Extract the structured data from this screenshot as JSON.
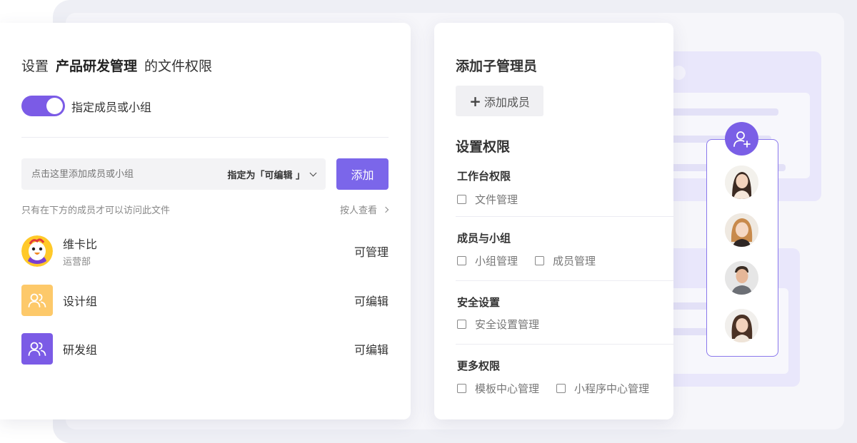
{
  "left_card": {
    "title_prefix": "设置",
    "title_name": "产品研发管理",
    "title_suffix": "的文件权限",
    "toggle_label": "指定成员或小组",
    "add_placeholder": "点击这里添加成员或小组",
    "perm_select": "指定为「可编辑 」",
    "add_button": "添加",
    "hint": "只有在下方的成员才可以访问此文件",
    "by_person": "按人查看",
    "members": [
      {
        "name": "维卡比",
        "dept": "运营部",
        "perm": "可管理",
        "avatar": "chick-avatar"
      },
      {
        "name": "设计组",
        "perm": "可编辑",
        "avatar": "group-icon",
        "color": "#fdc96a"
      },
      {
        "name": "研发组",
        "perm": "可编辑",
        "avatar": "group-icon",
        "color": "#7b5be6"
      }
    ]
  },
  "mid_card": {
    "sub_admin_title": "添加子管理员",
    "add_member": "添加成员",
    "perm_title": "设置权限",
    "groups": [
      {
        "title": "工作台权限",
        "options": [
          "文件管理"
        ]
      },
      {
        "title": "成员与小组",
        "options": [
          "小组管理",
          "成员管理"
        ]
      },
      {
        "title": "安全设置",
        "options": [
          "安全设置管理"
        ]
      },
      {
        "title": "更多权限",
        "options": [
          "模板中心管理",
          "小程序中心管理"
        ]
      }
    ]
  },
  "colors": {
    "accent": "#7b5be6",
    "button": "#7b66ea",
    "design_group": "#fdc96a"
  }
}
